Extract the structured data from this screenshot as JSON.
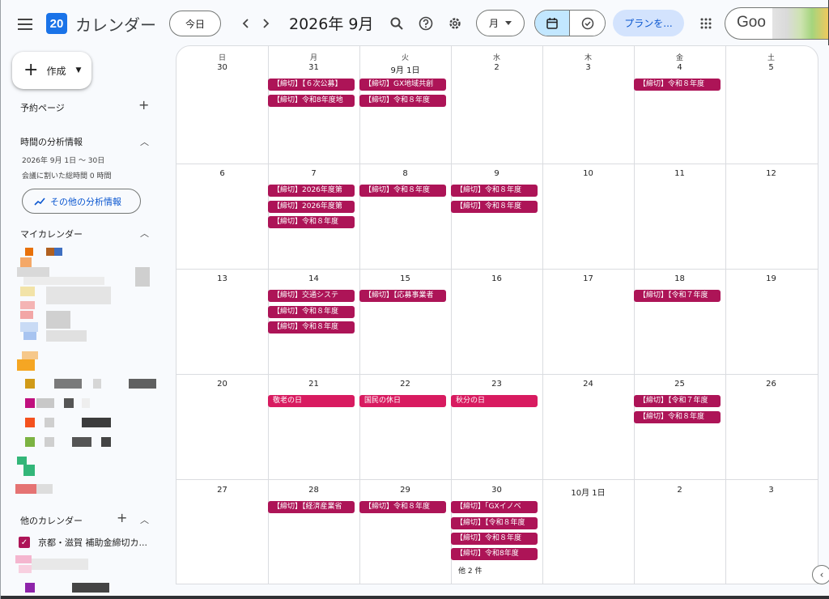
{
  "topbar": {
    "menu_icon": "hamburger-icon",
    "logo_text": "20",
    "app_title": "カレンダー",
    "today_label": "今日",
    "prev_icon": "‹",
    "next_icon": "›",
    "period_label": "2026年 9月",
    "view_label": "月",
    "plan_label": "プランを...",
    "account_label": "Goo"
  },
  "sidebar": {
    "create_label": "作成",
    "booking_label": "予約ページ",
    "analytics_title": "時間の分析情報",
    "analytics_range": "2026年 9月 1日 ～ 30日",
    "analytics_meeting": "会議に割いた総時間 0 時間",
    "analytics_more": "その他の分析情報",
    "my_calendars_label": "マイカレンダー",
    "other_calendars_label": "他のカレンダー",
    "other_calendar_item": "京都・滋賀 補助金締切カ..."
  },
  "calendar": {
    "weekdays": [
      "日",
      "月",
      "火",
      "水",
      "木",
      "金",
      "土"
    ],
    "weeks": [
      {
        "days": [
          "30",
          "31",
          "9月 1日",
          "2",
          "3",
          "4",
          "5"
        ]
      },
      {
        "days": [
          "6",
          "7",
          "8",
          "9",
          "10",
          "11",
          "12"
        ]
      },
      {
        "days": [
          "13",
          "14",
          "15",
          "16",
          "17",
          "18",
          "19"
        ]
      },
      {
        "days": [
          "20",
          "21",
          "22",
          "23",
          "24",
          "25",
          "26"
        ]
      },
      {
        "days": [
          "27",
          "28",
          "29",
          "30",
          "10月 1日",
          "2",
          "3"
        ]
      }
    ],
    "events": {
      "w0_mon_0": "【締切】【６次公募】",
      "w0_mon_1": "【締切】令和8年度地",
      "w0_tue_0": "【締切】GX地域共創",
      "w0_tue_1": "【締切】令和８年度",
      "w0_fri_0": "【締切】令和８年度",
      "w1_mon_0": "【締切】2026年度第",
      "w1_mon_1": "【締切】2026年度第",
      "w1_mon_2": "【締切】令和８年度",
      "w1_tue_0": "【締切】令和８年度",
      "w1_wed_0": "【締切】令和８年度",
      "w1_wed_1": "【締切】令和８年度",
      "w2_mon_0": "【締切】交通システ",
      "w2_mon_1": "【締切】令和８年度",
      "w2_mon_2": "【締切】令和８年度",
      "w2_tue_0": "【締切】【応募事業者",
      "w2_fri_0": "【締切】【令和７年度",
      "w3_mon_0": "敬老の日",
      "w3_tue_0": "国民の休日",
      "w3_wed_0": "秋分の日",
      "w3_fri_0": "【締切】【令和７年度",
      "w3_fri_1": "【締切】令和８年度",
      "w4_mon_0": "【締切】【経済産業省",
      "w4_tue_0": "【締切】令和８年度",
      "w4_wed_0": "【締切】「GXイノベ",
      "w4_wed_1": "【締切】【令和８年度",
      "w4_wed_2": "【締切】令和８年度",
      "w4_wed_3": "【締切】令和8年度",
      "w4_wed_more": "他 2 件"
    }
  },
  "colors": {
    "event": "#ad1457",
    "holiday": "#d81b60",
    "accent": "#1a73e8",
    "plan_bg": "#d3e3fd",
    "seg_active": "#c2e7ff"
  }
}
